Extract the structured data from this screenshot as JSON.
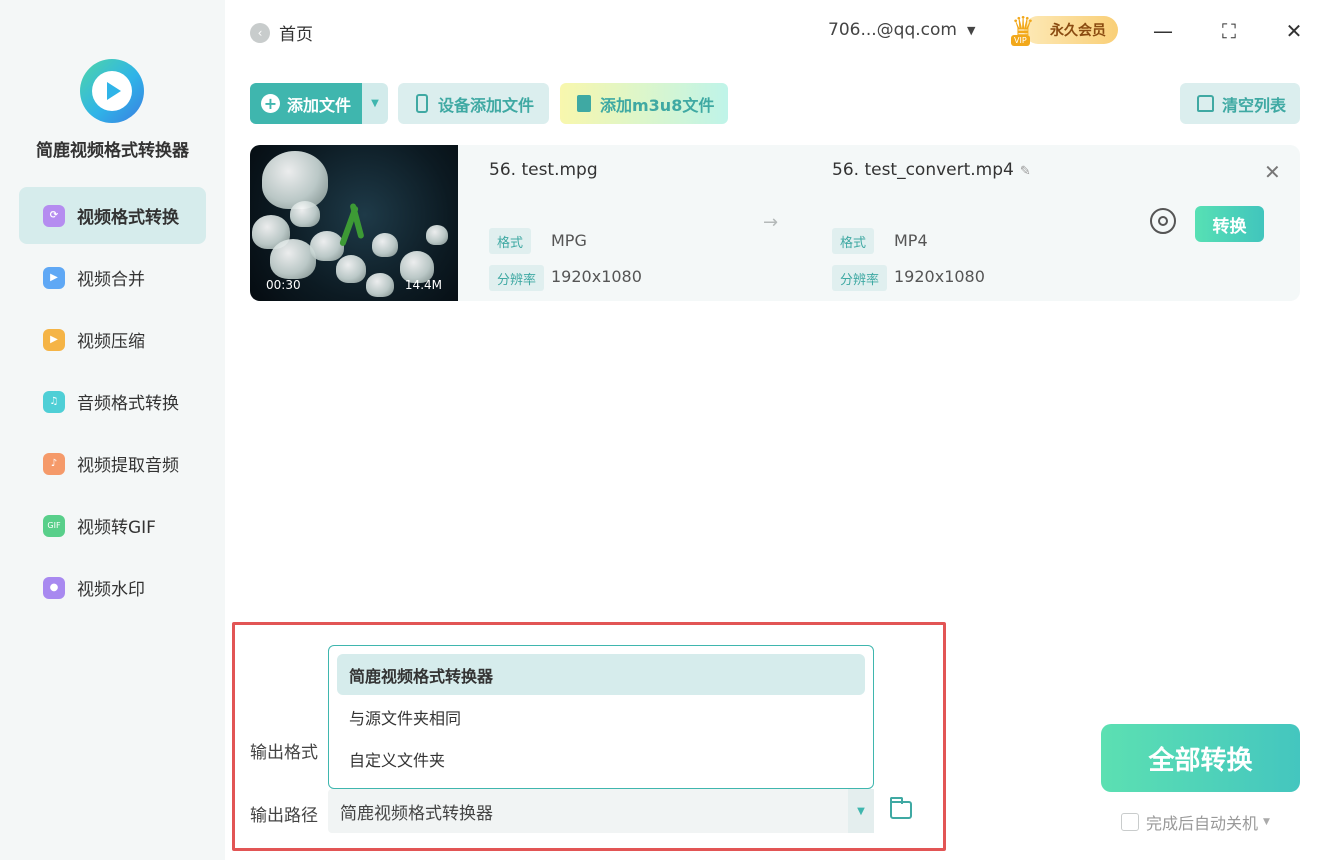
{
  "app": {
    "name": "简鹿视频格式转换器",
    "accent": "#3fb6ae"
  },
  "sidebar": {
    "items": [
      {
        "label": "视频格式转换",
        "icon": "video-convert-icon",
        "color": "#b58cf0",
        "active": true
      },
      {
        "label": "视频合并",
        "icon": "video-merge-icon",
        "color": "#5fa8f5",
        "active": false
      },
      {
        "label": "视频压缩",
        "icon": "video-compress-icon",
        "color": "#f5b446",
        "active": false
      },
      {
        "label": "音频格式转换",
        "icon": "audio-convert-icon",
        "color": "#4fcfd6",
        "active": false
      },
      {
        "label": "视频提取音频",
        "icon": "extract-audio-icon",
        "color": "#f59a6a",
        "active": false
      },
      {
        "label": "视频转GIF",
        "icon": "gif-icon",
        "color": "#58cf8a",
        "active": false
      },
      {
        "label": "视频水印",
        "icon": "watermark-icon",
        "color": "#a889f0",
        "active": false
      }
    ]
  },
  "topbar": {
    "home_label": "首页",
    "account": "706...@qq.com",
    "vip_label": "永久会员",
    "vip_badge": "VIP"
  },
  "toolbar": {
    "add_file": "添加文件",
    "device_add": "设备添加文件",
    "add_m3u8": "添加m3u8文件",
    "clear_list": "清空列表"
  },
  "file": {
    "duration": "00:30",
    "size": "14.4M",
    "source_name": "56. test.mpg",
    "target_name": "56. test_convert.mp4",
    "format_tag": "格式",
    "resolution_tag": "分辨率",
    "source_format": "MPG",
    "source_resolution": "1920x1080",
    "target_format": "MP4",
    "target_resolution": "1920x1080",
    "convert_label": "转换"
  },
  "output": {
    "format_label": "输出格式",
    "path_label": "输出路径",
    "path_value": "简鹿视频格式转换器",
    "options": [
      "简鹿视频格式转换器",
      "与源文件夹相同",
      "自定义文件夹"
    ],
    "selected_index": 0
  },
  "actions": {
    "convert_all": "全部转换",
    "shutdown_label": "完成后自动关机"
  }
}
